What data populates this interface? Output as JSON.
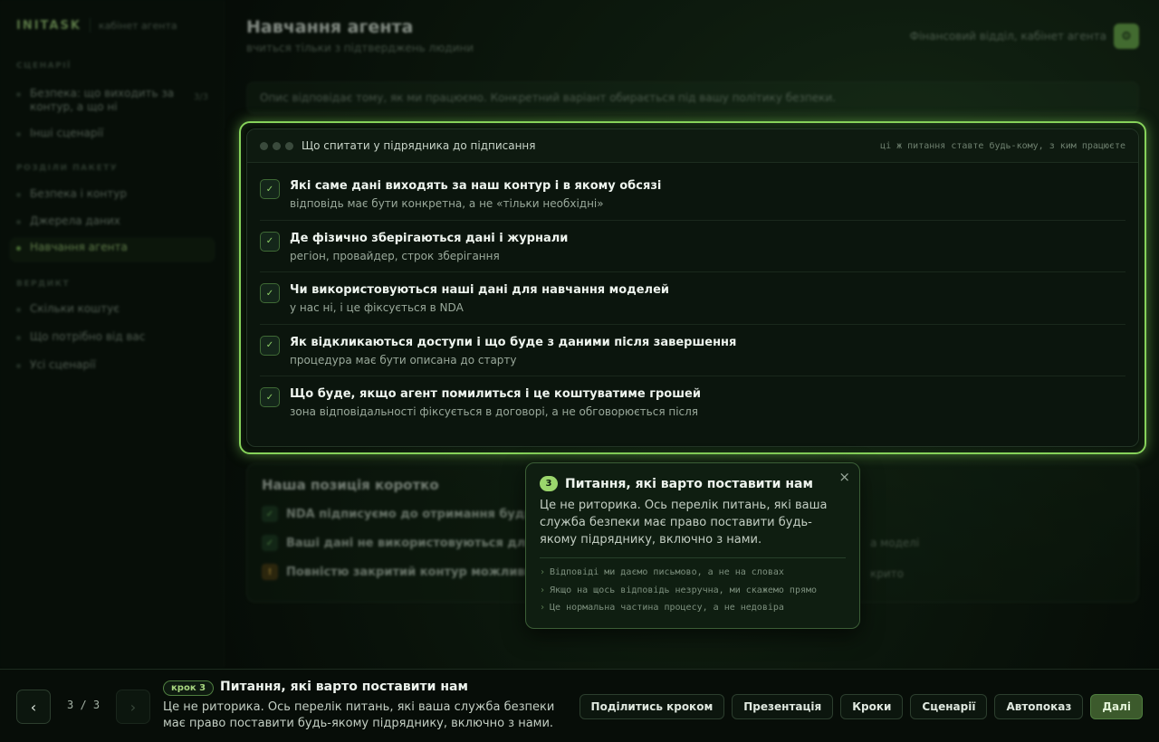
{
  "sidebar": {
    "brand": "INITASK",
    "brand_sub": "кабінет агента",
    "sections": [
      {
        "title": "СЦЕНАРІЇ",
        "items": [
          {
            "label": "Безпека: що виходить за контур, а що ні",
            "count": "3/3"
          },
          {
            "label": "Інші сценарії"
          }
        ]
      },
      {
        "title": "РОЗДІЛИ ПАКЕТУ",
        "items": [
          {
            "label": "Безпека і контур"
          },
          {
            "label": "Джерела даних"
          },
          {
            "label": "Навчання агента",
            "active": true
          }
        ]
      },
      {
        "title": "ВЕРДИКТ",
        "items": [
          {
            "label": "Скільки коштує"
          },
          {
            "label": "Що потрібно від вас"
          },
          {
            "label": "Усі сценарії"
          }
        ]
      }
    ]
  },
  "header": {
    "title": "Навчання агента",
    "subtitle": "вчиться тільки з підтверджень людини",
    "right_text": "Фінансовий відділ, кабінет агента",
    "avatar_icon": "gear-icon"
  },
  "note": "Опис відповідає тому, як ми працюємо. Конкретний варіант обирається під вашу політику безпеки.",
  "card": {
    "title": "Що спитати у підрядника до підписання",
    "hint": "ці ж питання ставте будь-кому, з ким працюєте",
    "check_glyph": "✓",
    "questions": [
      {
        "title": "Які саме дані виходять за наш контур і в якому обсязі",
        "sub": "відповідь має бути конкретна, а не «тільки необхідні»"
      },
      {
        "title": "Де фізично зберігаються дані і журнали",
        "sub": "регіон, провайдер, строк зберігання"
      },
      {
        "title": "Чи використовуються наші дані для навчання моделей",
        "sub": "у нас ні, і це фіксується в NDA"
      },
      {
        "title": "Як відкликаються доступи і що буде з даними після завершення",
        "sub": "процедура має бути описана до старту"
      },
      {
        "title": "Що буде, якщо агент помилиться і це коштуватиме грошей",
        "sub": "зона відповідальності фіксується в договорі, а не обговорюється після"
      }
    ]
  },
  "position": {
    "title": "Наша позиція коротко",
    "rows": [
      {
        "text": "NDA підписуємо до отримання будь",
        "icon": "✓",
        "tail": ""
      },
      {
        "text": "Ваші дані не використовуються для",
        "icon": "✓",
        "tail": "а моделі"
      },
      {
        "text": "Повністю закритий контур можливи",
        "icon": "!",
        "tail": "крито"
      }
    ]
  },
  "popover": {
    "step_num": "3",
    "title": "Питання, які варто поставити нам",
    "close": "×",
    "body": "Це не риторика. Ось перелік питань, які ваша служба безпеки має право поставити будь-якому підряднику, включно з нами.",
    "bullet_glyph": "›",
    "bullets": [
      "Відповіді ми даємо письмово, а не на словах",
      "Якщо на щось відповідь незручна, ми скажемо прямо",
      "Це нормальна частина процесу, а не недовіра"
    ]
  },
  "bottom": {
    "prev": "‹",
    "next": "›",
    "counter": "3 / 3",
    "step_badge": "крок 3",
    "step_title": "Питання, які варто поставити нам",
    "step_desc": "Це не риторика. Ось перелік питань, які ваша служба безпеки має право поставити будь-якому підряднику, включно з нами.",
    "buttons": [
      "Поділитись кроком",
      "Презентація",
      "Кроки",
      "Сценарії",
      "Автопоказ"
    ],
    "primary": "Далі"
  }
}
